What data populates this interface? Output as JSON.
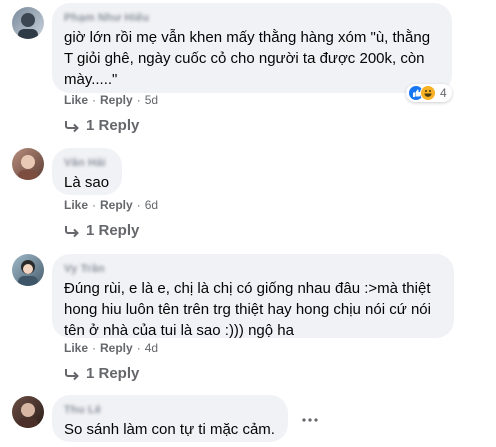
{
  "comments": [
    {
      "author": "Phạm Như Hiếu",
      "text": "giờ lớn rồi mẹ vẫn khen mấy thằng hàng xóm \"ù, thằng T giỏi ghê, ngày cuốc cỏ cho người ta được 200k, còn mày.....\"",
      "like_label": "Like",
      "reply_label": "Reply",
      "time": "5d",
      "replies_label": "1 Reply",
      "reaction_count": "4",
      "reactions": [
        "like-icon",
        "haha-icon"
      ]
    },
    {
      "author": "Văn Hải",
      "text": "Là sao",
      "like_label": "Like",
      "reply_label": "Reply",
      "time": "6d",
      "replies_label": "1 Reply"
    },
    {
      "author": "Vy Trần",
      "text": "Đúng rùi, e là e, chị là chị có giống nhau đâu :>mà thiệt hong hiu luôn tên trên trg thiệt hay hong chịu nói cứ nói tên ở nhà của tui là sao :))) ngộ ha",
      "like_label": "Like",
      "reply_label": "Reply",
      "time": "4d",
      "replies_label": "1 Reply"
    },
    {
      "author": "Thu Lê",
      "text": "So sánh làm con tự ti mặc cảm."
    }
  ],
  "colors": {
    "bubble": "#f0f2f5",
    "meta_text": "#65676b",
    "like_blue": "#1877f2",
    "haha_yellow": "#f7b125"
  }
}
